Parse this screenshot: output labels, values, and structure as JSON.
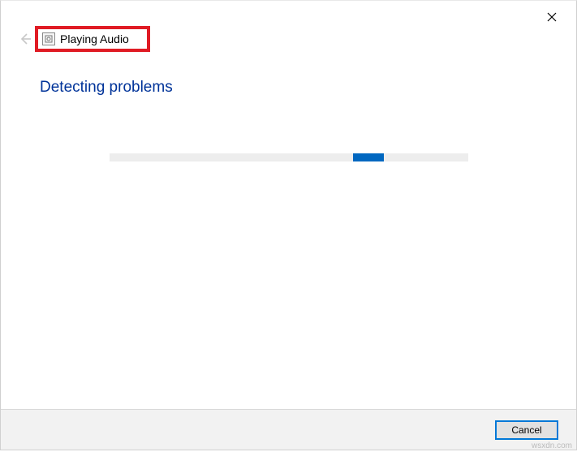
{
  "titlebar": {
    "close_label": "Close"
  },
  "header": {
    "back_label": "Back",
    "troubleshooter_icon": "diagnostic-icon",
    "title": "Playing Audio"
  },
  "content": {
    "status_heading": "Detecting problems",
    "progress_percent": 70
  },
  "footer": {
    "cancel_label": "Cancel"
  },
  "watermark": "wsxdn.com"
}
